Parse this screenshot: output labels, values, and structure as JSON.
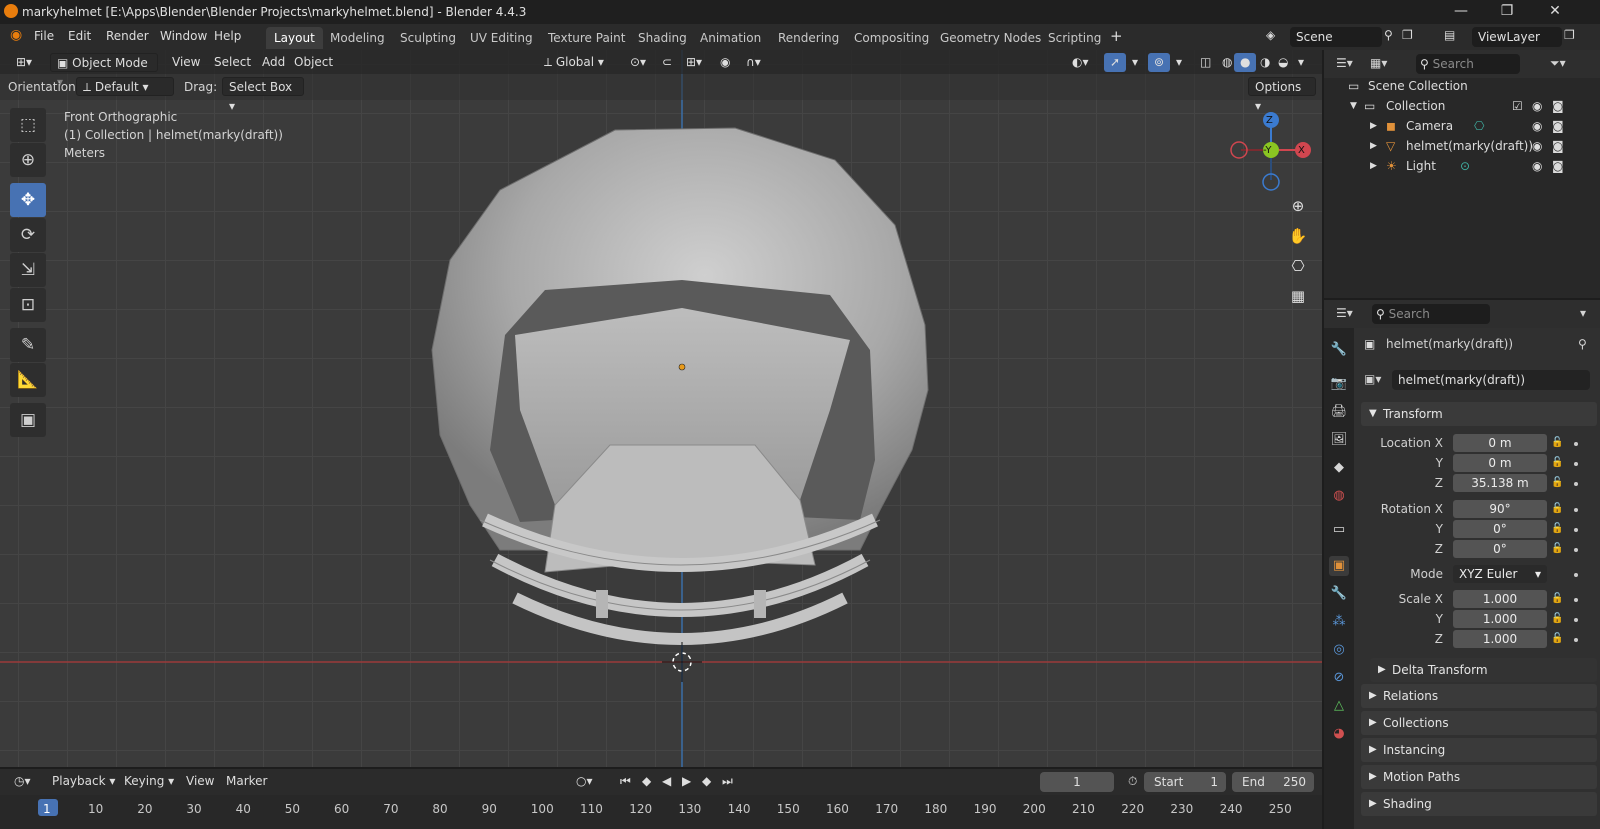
{
  "window": {
    "title": "markyhelmet [E:\\Apps\\Blender\\Blender Projects\\markyhelmet.blend] - Blender 4.4.3",
    "controls": [
      "—",
      "❐",
      "✕"
    ]
  },
  "menu": [
    "File",
    "Edit",
    "Render",
    "Window",
    "Help"
  ],
  "workspaces": [
    "Layout",
    "Modeling",
    "Sculpting",
    "UV Editing",
    "Texture Paint",
    "Shading",
    "Animation",
    "Rendering",
    "Compositing",
    "Geometry Nodes",
    "Scripting"
  ],
  "active_workspace": "Layout",
  "scene": {
    "scene_name": "Scene",
    "view_layer": "ViewLayer"
  },
  "viewport_header": {
    "mode": "Object Mode",
    "menus": [
      "View",
      "Select",
      "Add",
      "Object"
    ],
    "transform_orientation": "Global"
  },
  "tool_settings": {
    "orientation_label": "Orientation:",
    "orientation_value": "Default",
    "drag_label": "Drag:",
    "drag_value": "Select Box",
    "options_label": "Options"
  },
  "viewport_info": {
    "view_name": "Front Orthographic",
    "collection_line": "(1) Collection | helmet(marky(draft))",
    "units": "Meters"
  },
  "gizmo": {
    "z": "Z",
    "y": "-Y",
    "x": "X"
  },
  "outliner": {
    "search_placeholder": "Search",
    "root": "Scene Collection",
    "collection": "Collection",
    "items": [
      {
        "name": "Camera"
      },
      {
        "name": "helmet(marky(draft))"
      },
      {
        "name": "Light"
      }
    ]
  },
  "properties": {
    "search_placeholder": "Search",
    "object_name": "helmet(marky(draft))",
    "object_datablock": "helmet(marky(draft))",
    "transform_title": "Transform",
    "location_label": "Location X",
    "location": {
      "x": "0 m",
      "y": "0 m",
      "z": "35.138 m"
    },
    "rotation_label": "Rotation X",
    "rotation": {
      "x": "90°",
      "y": "0°",
      "z": "0°"
    },
    "mode_label": "Mode",
    "rotation_mode": "XYZ Euler",
    "scale_label": "Scale X",
    "scale": {
      "x": "1.000",
      "y": "1.000",
      "z": "1.000"
    },
    "axis_y": "Y",
    "axis_z": "Z",
    "subpanels": [
      "Delta Transform",
      "Relations",
      "Collections",
      "Instancing",
      "Motion Paths",
      "Shading"
    ]
  },
  "timeline": {
    "menus": [
      "Playback",
      "Keying",
      "View",
      "Marker"
    ],
    "current_frame": "1",
    "start_label": "Start",
    "start": "1",
    "end_label": "End",
    "end": "250",
    "ticks": [
      "1",
      "10",
      "20",
      "30",
      "40",
      "50",
      "60",
      "70",
      "80",
      "90",
      "100",
      "110",
      "120",
      "130",
      "140",
      "150",
      "160",
      "170",
      "180",
      "190",
      "200",
      "210",
      "220",
      "230",
      "240",
      "250"
    ]
  }
}
